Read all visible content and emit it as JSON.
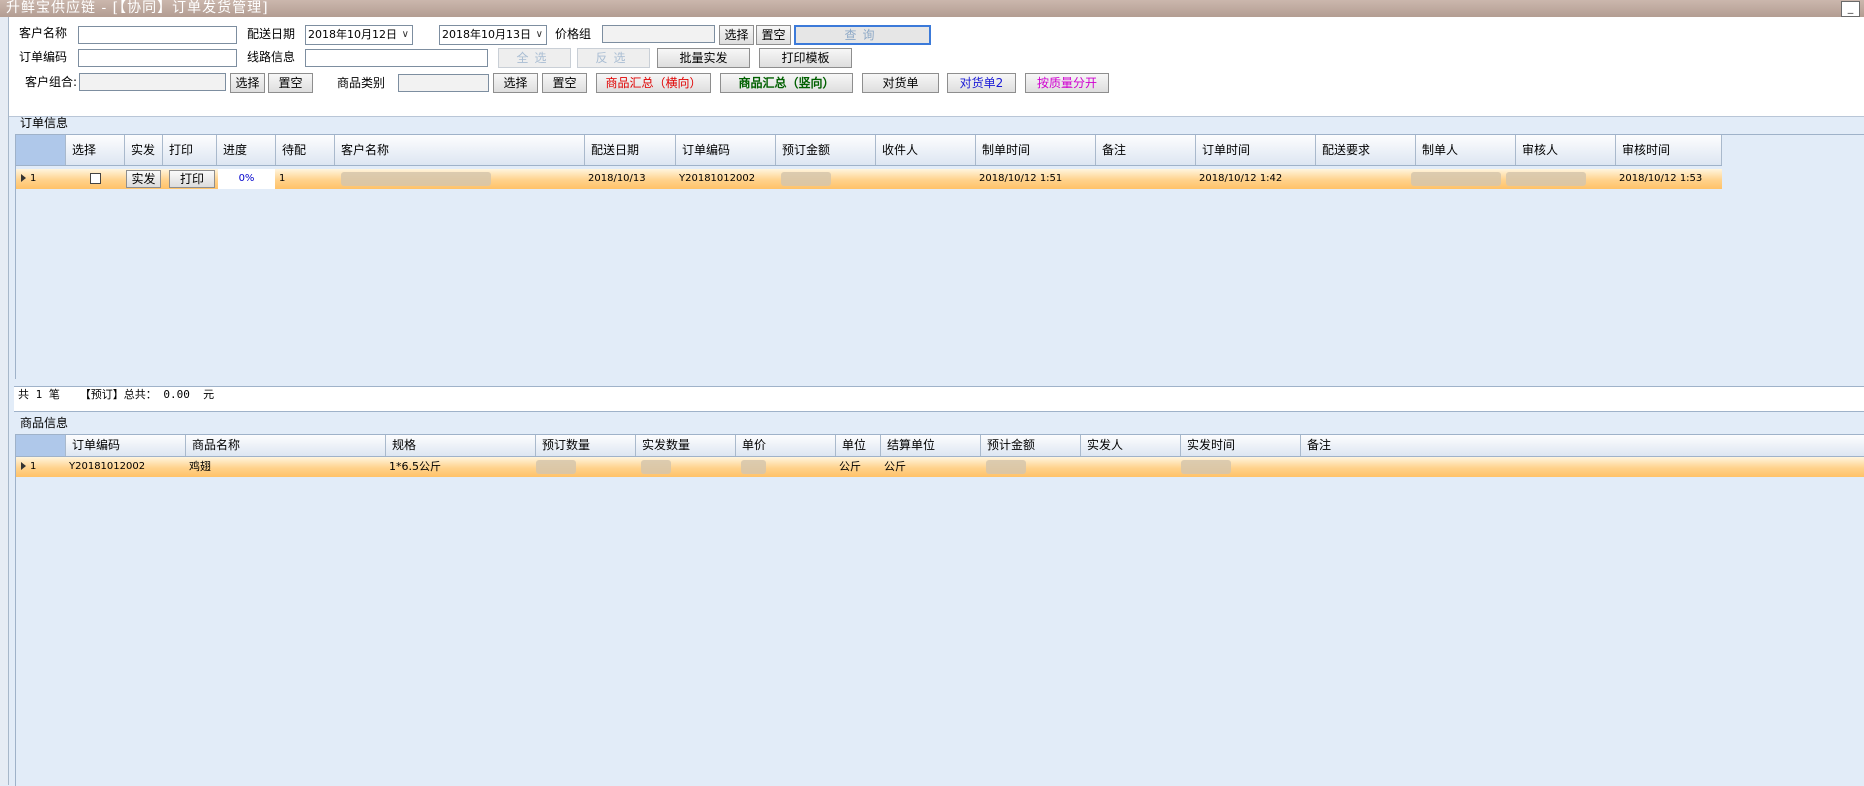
{
  "window": {
    "title": "升鲜宝供应链 - [【协同】订单发货管理]",
    "minimize_glyph": "_"
  },
  "filters": {
    "customer_name_label": "客户名称",
    "order_code_label": "订单编码",
    "customer_group_label": "客户组合:",
    "delivery_date_label": "配送日期",
    "date_from": "2018年10月12日",
    "date_to": "2018年10月13日",
    "route_info_label": "线路信息",
    "price_group_label": "价格组",
    "product_category_label": "商品类别"
  },
  "buttons": {
    "select": "选择",
    "clear": "置空",
    "query": "查询",
    "select_all": "全选",
    "invert": "反选",
    "batch_ship": "批量实发",
    "print_template": "打印模板",
    "goods_summary_h": "商品汇总（横向）",
    "goods_summary_v": "商品汇总（竖向）",
    "reconcile": "对货单",
    "reconcile2": "对货单2",
    "split_by_quality": "按质量分开"
  },
  "orders": {
    "section_label": "订单信息",
    "columns": [
      "选择",
      "实发",
      "打印",
      "进度",
      "待配",
      "客户名称",
      "配送日期",
      "订单编码",
      "预订金额",
      "收件人",
      "制单时间",
      "备注",
      "订单时间",
      "配送要求",
      "制单人",
      "审核人",
      "审核时间"
    ],
    "rows": [
      {
        "index": "1",
        "ship_btn": "实发",
        "print_btn": "打印",
        "progress": "0%",
        "pending": "1",
        "delivery_date": "2018/10/13",
        "order_code": "Y20181012002",
        "made_time": "2018/10/12  1:51",
        "order_time": "2018/10/12  1:42",
        "audit_time": "2018/10/12  1:53"
      }
    ]
  },
  "summary": {
    "text": "共 1 笔   【预订】总共： 0.00  元"
  },
  "products": {
    "section_label": "商品信息",
    "columns": [
      "订单编码",
      "商品名称",
      "规格",
      "预订数量",
      "实发数量",
      "单价",
      "单位",
      "结算单位",
      "预计金额",
      "实发人",
      "实发时间",
      "备注"
    ],
    "rows": [
      {
        "index": "1",
        "order_code": "Y20181012002",
        "product_name": "鸡翅",
        "spec": "1*6.5公斤",
        "unit": "公斤",
        "settle_unit": "公斤"
      }
    ]
  }
}
